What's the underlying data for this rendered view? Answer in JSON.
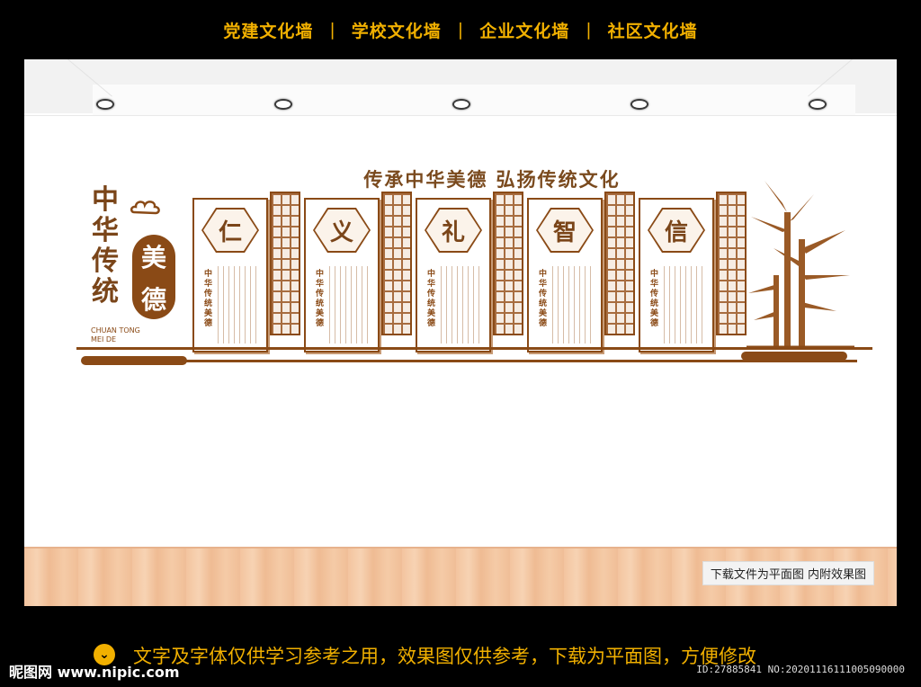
{
  "nav": {
    "items": [
      "党建文化墙",
      "学校文化墙",
      "企业文化墙",
      "社区文化墙"
    ],
    "separator": "|"
  },
  "headline": "传承中华美德  弘扬传统文化",
  "brand": {
    "vertical": [
      "中",
      "华",
      "传",
      "统"
    ],
    "badge": [
      "美",
      "德"
    ],
    "english_line1": "CHUAN TONG",
    "english_line2": "MEI DE"
  },
  "panels": [
    {
      "char": "仁",
      "subtitle": "中华传统美德"
    },
    {
      "char": "义",
      "subtitle": "中华传统美德"
    },
    {
      "char": "礼",
      "subtitle": "中华传统美德"
    },
    {
      "char": "智",
      "subtitle": "中华传统美德"
    },
    {
      "char": "信",
      "subtitle": "中华传统美德"
    }
  ],
  "floor_note": "下载文件为平面图  内附效果图",
  "tip": "文字及字体仅供学习参考之用，效果图仅供参考，下载为平面图，方便修改",
  "watermark": "昵图网 www.nipic.com",
  "image_id": "ID:27885841 NO:20201116111005090000",
  "colors": {
    "accent": "#8a4a16",
    "nav": "#f1b000"
  }
}
